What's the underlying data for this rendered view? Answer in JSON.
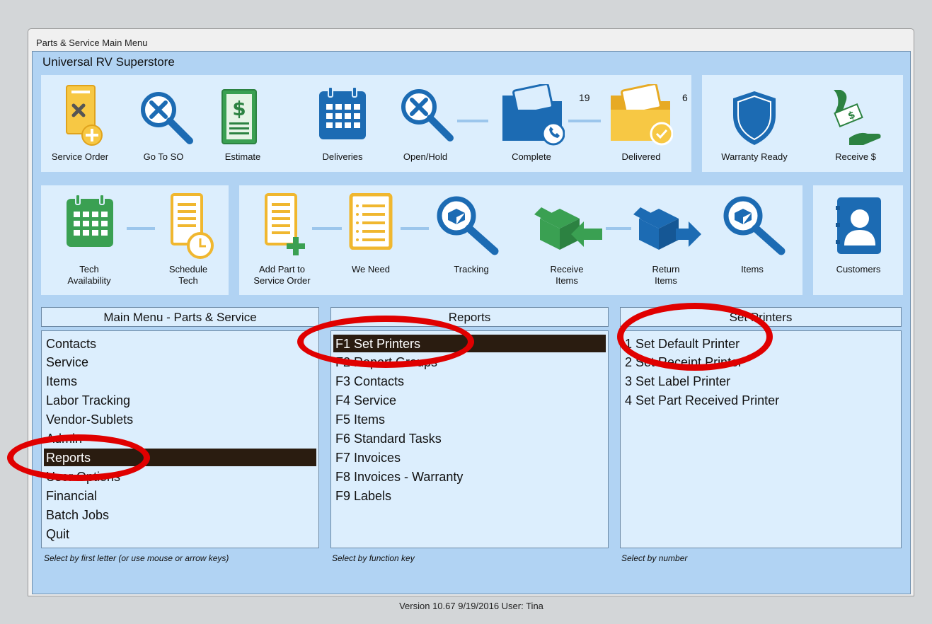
{
  "window": {
    "title": "Parts & Service Main Menu"
  },
  "company": "Universal RV Superstore",
  "toolbar_row1": {
    "service_order": "Service Order",
    "go_to_so": "Go To SO",
    "estimate": "Estimate",
    "deliveries": "Deliveries",
    "open_hold": "Open/Hold",
    "complete": "Complete",
    "complete_count": "19",
    "delivered": "Delivered",
    "delivered_count": "6",
    "warranty_ready": "Warranty Ready",
    "receive_money": "Receive $"
  },
  "toolbar_row2": {
    "tech_availability_1": "Tech",
    "tech_availability_2": "Availability",
    "schedule_tech_1": "Schedule",
    "schedule_tech_2": "Tech",
    "add_part_1": "Add Part to",
    "add_part_2": "Service Order",
    "we_need": "We Need",
    "tracking": "Tracking",
    "receive_items_1": "Receive",
    "receive_items_2": "Items",
    "return_items_1": "Return",
    "return_items_2": "Items",
    "items": "Items",
    "customers": "Customers"
  },
  "main_menu": {
    "title": "Main Menu - Parts & Service",
    "items": [
      "Contacts",
      "Service",
      "Items",
      "Labor Tracking",
      "Vendor-Sublets",
      "Admin",
      "Reports",
      "User Options",
      "Financial",
      "Batch Jobs",
      "Quit"
    ],
    "hint": "Select by first letter (or use mouse or arrow keys)"
  },
  "reports_menu": {
    "title": "Reports",
    "items": [
      "F1 Set Printers",
      "F2 Report Groups",
      "F3 Contacts",
      "F4 Service",
      "F5 Items",
      "F6 Standard Tasks",
      "F7 Invoices",
      "F8 Invoices - Warranty",
      "F9 Labels"
    ],
    "hint": "Select by function key"
  },
  "printers_menu": {
    "title": "Set Printers",
    "items": [
      "1 Set Default Printer",
      "2 Set Receipt Printer",
      "3 Set Label Printer",
      "4 Set Part Received Printer"
    ],
    "hint": "Select by number"
  },
  "version": "Version 10.67  9/19/2016   User: Tina",
  "colors": {
    "selection": "#2a1c10",
    "annotation": "#e00000",
    "panel": "#dceefd",
    "background": "#b1d3f3"
  }
}
